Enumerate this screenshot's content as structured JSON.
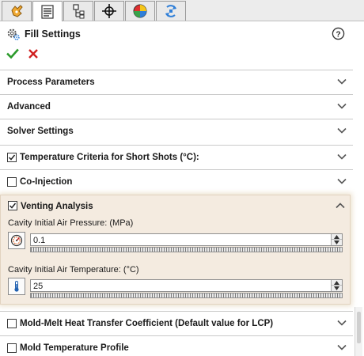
{
  "tabs": [
    {
      "icon": "feature-manager-icon",
      "active": false
    },
    {
      "icon": "property-manager-icon",
      "active": true
    },
    {
      "icon": "configuration-manager-icon",
      "active": false
    },
    {
      "icon": "dimxpert-manager-icon",
      "active": false
    },
    {
      "icon": "display-manager-icon",
      "active": false
    },
    {
      "icon": "plastics-manager-icon",
      "active": false
    }
  ],
  "header": {
    "title": "Fill Settings",
    "icon": "settings-gear-icon",
    "help_icon": "help-icon"
  },
  "actions": {
    "ok_icon": "checkmark-icon",
    "cancel_icon": "close-icon",
    "ok_color": "#2a9a2a",
    "cancel_color": "#d02020"
  },
  "groups": {
    "process_parameters": "Process Parameters",
    "advanced": "Advanced",
    "solver_settings": "Solver Settings",
    "temperature_criteria": "Temperature Criteria for Short Shots  (°C):",
    "co_injection": "Co-Injection",
    "venting_analysis": "Venting Analysis",
    "mold_melt": "Mold-Melt Heat Transfer Coefficient (Default value for LCP)",
    "mold_temp_profile": "Mold Temperature Profile"
  },
  "checks": {
    "temperature_criteria": true,
    "co_injection": false,
    "venting_analysis": true,
    "mold_melt": false,
    "mold_temp_profile": false
  },
  "venting": {
    "pressure_label": "Cavity Initial Air Pressure: (MPa)",
    "pressure_value": "0.1",
    "pressure_icon": "pressure-gauge-icon",
    "temperature_label": "Cavity Initial Air Temperature: (°C)",
    "temperature_value": "25",
    "temperature_icon": "thermometer-icon"
  },
  "colors": {
    "expanded_group_bg": "#f4ebe0",
    "divider": "#c9c9c9"
  }
}
